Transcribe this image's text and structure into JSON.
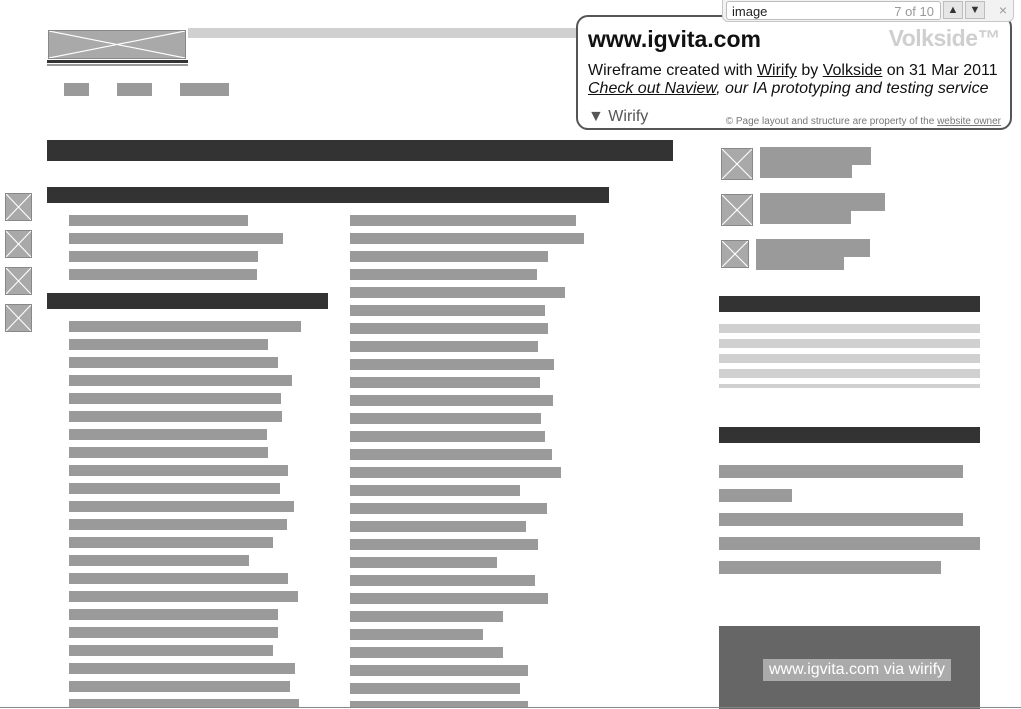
{
  "find_bar": {
    "query": "image",
    "match_count": "7 of 10",
    "prev_label": "▲",
    "next_label": "▼",
    "close_label": "×"
  },
  "info_panel": {
    "site": "www.igvita.com",
    "brand": "Volkside™",
    "credit_prefix": "Wireframe created with ",
    "credit_tool": "Wirify",
    "credit_by": " by ",
    "credit_company": "Volkside",
    "credit_date": " on 31 Mar 2011",
    "promo_link": "Check out Naview",
    "promo_rest": ", our IA prototyping and testing service",
    "toggle_label": "▼ Wirify",
    "copyright_prefix": "©  Page layout and structure are property of the ",
    "copyright_link": "website owner"
  },
  "footer": {
    "tag": "www.igvita.com via wirify"
  }
}
